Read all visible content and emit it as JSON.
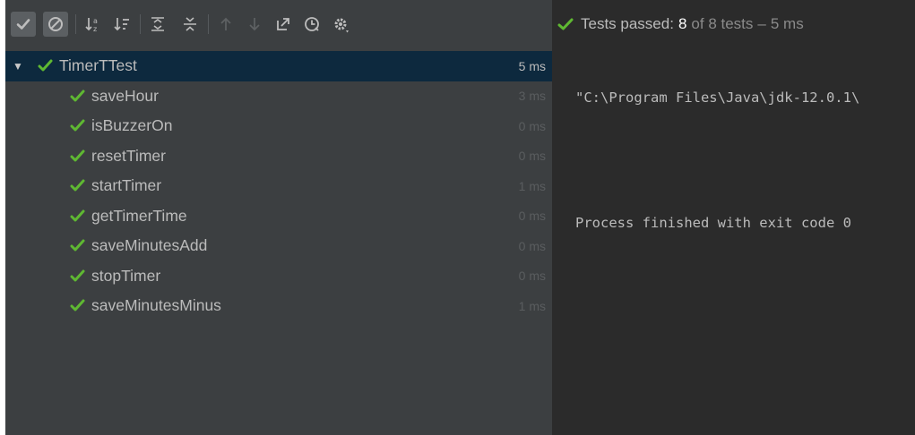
{
  "toolbar": {
    "buttons": [
      {
        "icon": "show-passed-icon"
      },
      {
        "icon": "show-ignored-icon"
      },
      {
        "icon": "sort-alphabetically-icon"
      },
      {
        "icon": "sort-by-duration-icon"
      },
      {
        "icon": "expand-all-icon"
      },
      {
        "icon": "collapse-all-icon"
      },
      {
        "icon": "previous-failed-test-icon"
      },
      {
        "icon": "next-failed-test-icon"
      },
      {
        "icon": "export-test-results-icon"
      },
      {
        "icon": "test-history-icon"
      },
      {
        "icon": "settings-icon"
      }
    ]
  },
  "status": {
    "prefix": "Tests passed:",
    "passed": "8",
    "of_total": "of 8 tests",
    "dash": "–",
    "duration": "5 ms"
  },
  "tree": {
    "root": {
      "name": "TimerTTest",
      "time": "5 ms"
    },
    "tests": [
      {
        "name": "saveHour",
        "time": "3 ms"
      },
      {
        "name": "isBuzzerOn",
        "time": "0 ms"
      },
      {
        "name": "resetTimer",
        "time": "0 ms"
      },
      {
        "name": "startTimer",
        "time": "1 ms"
      },
      {
        "name": "getTimerTime",
        "time": "0 ms"
      },
      {
        "name": "saveMinutesAdd",
        "time": "0 ms"
      },
      {
        "name": "stopTimer",
        "time": "0 ms"
      },
      {
        "name": "saveMinutesMinus",
        "time": "1 ms"
      }
    ]
  },
  "console": {
    "lines": [
      "\"C:\\Program Files\\Java\\jdk-12.0.1\\",
      "",
      "Process finished with exit code 0"
    ]
  },
  "colors": {
    "check_green": "#5fb832",
    "selection": "#0d293e",
    "panel_bg": "#3c3f41",
    "console_bg": "#2b2b2b"
  }
}
